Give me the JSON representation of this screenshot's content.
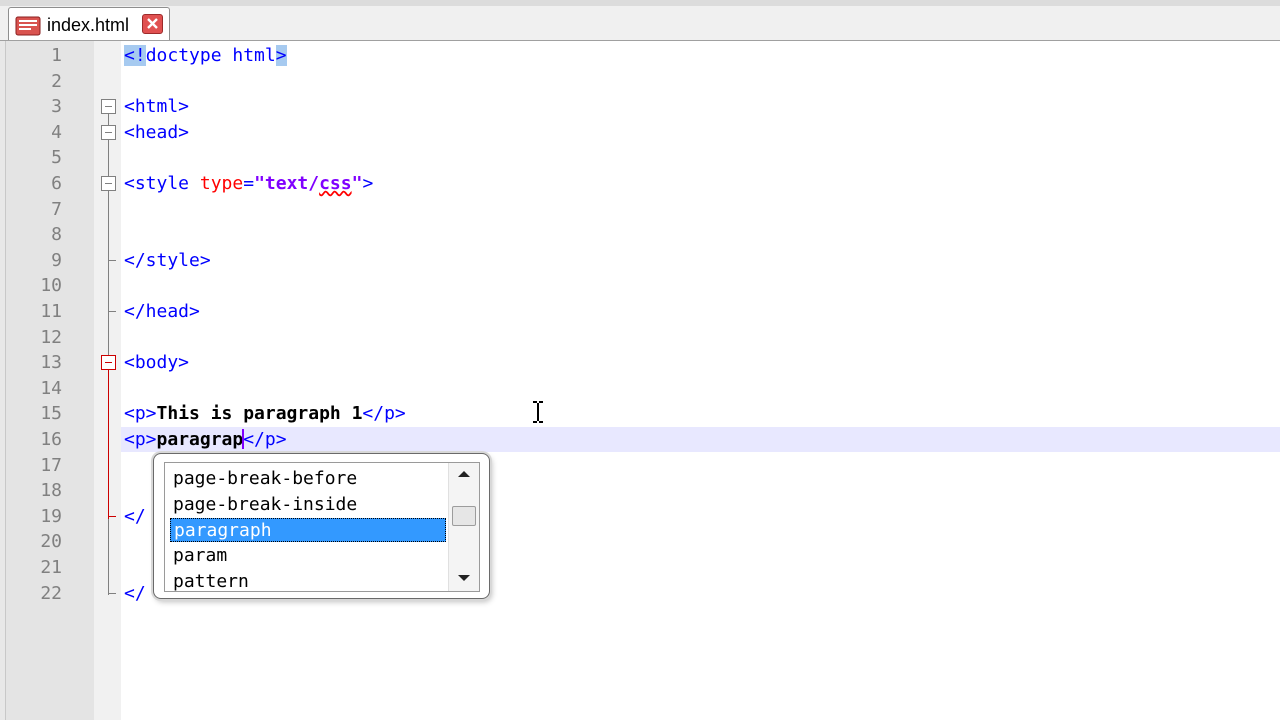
{
  "tab": {
    "title": "index.html",
    "icon": "html-file-icon",
    "close_icon": "close-icon"
  },
  "colors": {
    "tag": "#0000ff",
    "attr": "#ff0000",
    "value": "#8000ff",
    "selection": "#3399ff",
    "current_line": "#e8e8ff"
  },
  "lines": [
    {
      "n": "1",
      "parts": [
        {
          "t": "<!",
          "c": "tag hl"
        },
        {
          "t": "doctype html",
          "c": "tag"
        },
        {
          "t": ">",
          "c": "tag hl"
        }
      ]
    },
    {
      "n": "2",
      "parts": []
    },
    {
      "n": "3",
      "parts": [
        {
          "t": "<html>",
          "c": "tag"
        }
      ]
    },
    {
      "n": "4",
      "parts": [
        {
          "t": "<head>",
          "c": "tag"
        }
      ]
    },
    {
      "n": "5",
      "parts": []
    },
    {
      "n": "6",
      "parts": [
        {
          "t": "<style ",
          "c": "tag"
        },
        {
          "t": "type",
          "c": "attr"
        },
        {
          "t": "=",
          "c": "tag"
        },
        {
          "t": "\"text/",
          "c": "val"
        },
        {
          "t": "css",
          "c": "val squiggle"
        },
        {
          "t": "\"",
          "c": "val"
        },
        {
          "t": ">",
          "c": "tag"
        }
      ]
    },
    {
      "n": "7",
      "parts": []
    },
    {
      "n": "8",
      "parts": []
    },
    {
      "n": "9",
      "parts": [
        {
          "t": "</style>",
          "c": "tag"
        }
      ]
    },
    {
      "n": "10",
      "parts": []
    },
    {
      "n": "11",
      "parts": [
        {
          "t": "</head>",
          "c": "tag"
        }
      ]
    },
    {
      "n": "12",
      "parts": []
    },
    {
      "n": "13",
      "parts": [
        {
          "t": "<body>",
          "c": "tag"
        }
      ]
    },
    {
      "n": "14",
      "parts": []
    },
    {
      "n": "15",
      "parts": [
        {
          "t": "<p>",
          "c": "tag"
        },
        {
          "t": "This is paragraph 1",
          "c": ""
        },
        {
          "t": "</p>",
          "c": "tag"
        }
      ]
    },
    {
      "n": "16",
      "parts": [
        {
          "t": "<p>",
          "c": "tag"
        },
        {
          "t": "paragrap",
          "c": ""
        },
        {
          "t": "",
          "c": "caret"
        },
        {
          "t": "</p>",
          "c": "tag"
        }
      ]
    },
    {
      "n": "17",
      "parts": []
    },
    {
      "n": "18",
      "parts": []
    },
    {
      "n": "19",
      "parts": [
        {
          "t": "</",
          "c": "tag"
        }
      ]
    },
    {
      "n": "20",
      "parts": []
    },
    {
      "n": "21",
      "parts": []
    },
    {
      "n": "22",
      "parts": [
        {
          "t": "</",
          "c": "tag"
        }
      ]
    }
  ],
  "autocomplete": {
    "items": [
      "page-break-before",
      "page-break-inside",
      "paragraph",
      "param",
      "pattern"
    ],
    "selected_index": 2
  }
}
